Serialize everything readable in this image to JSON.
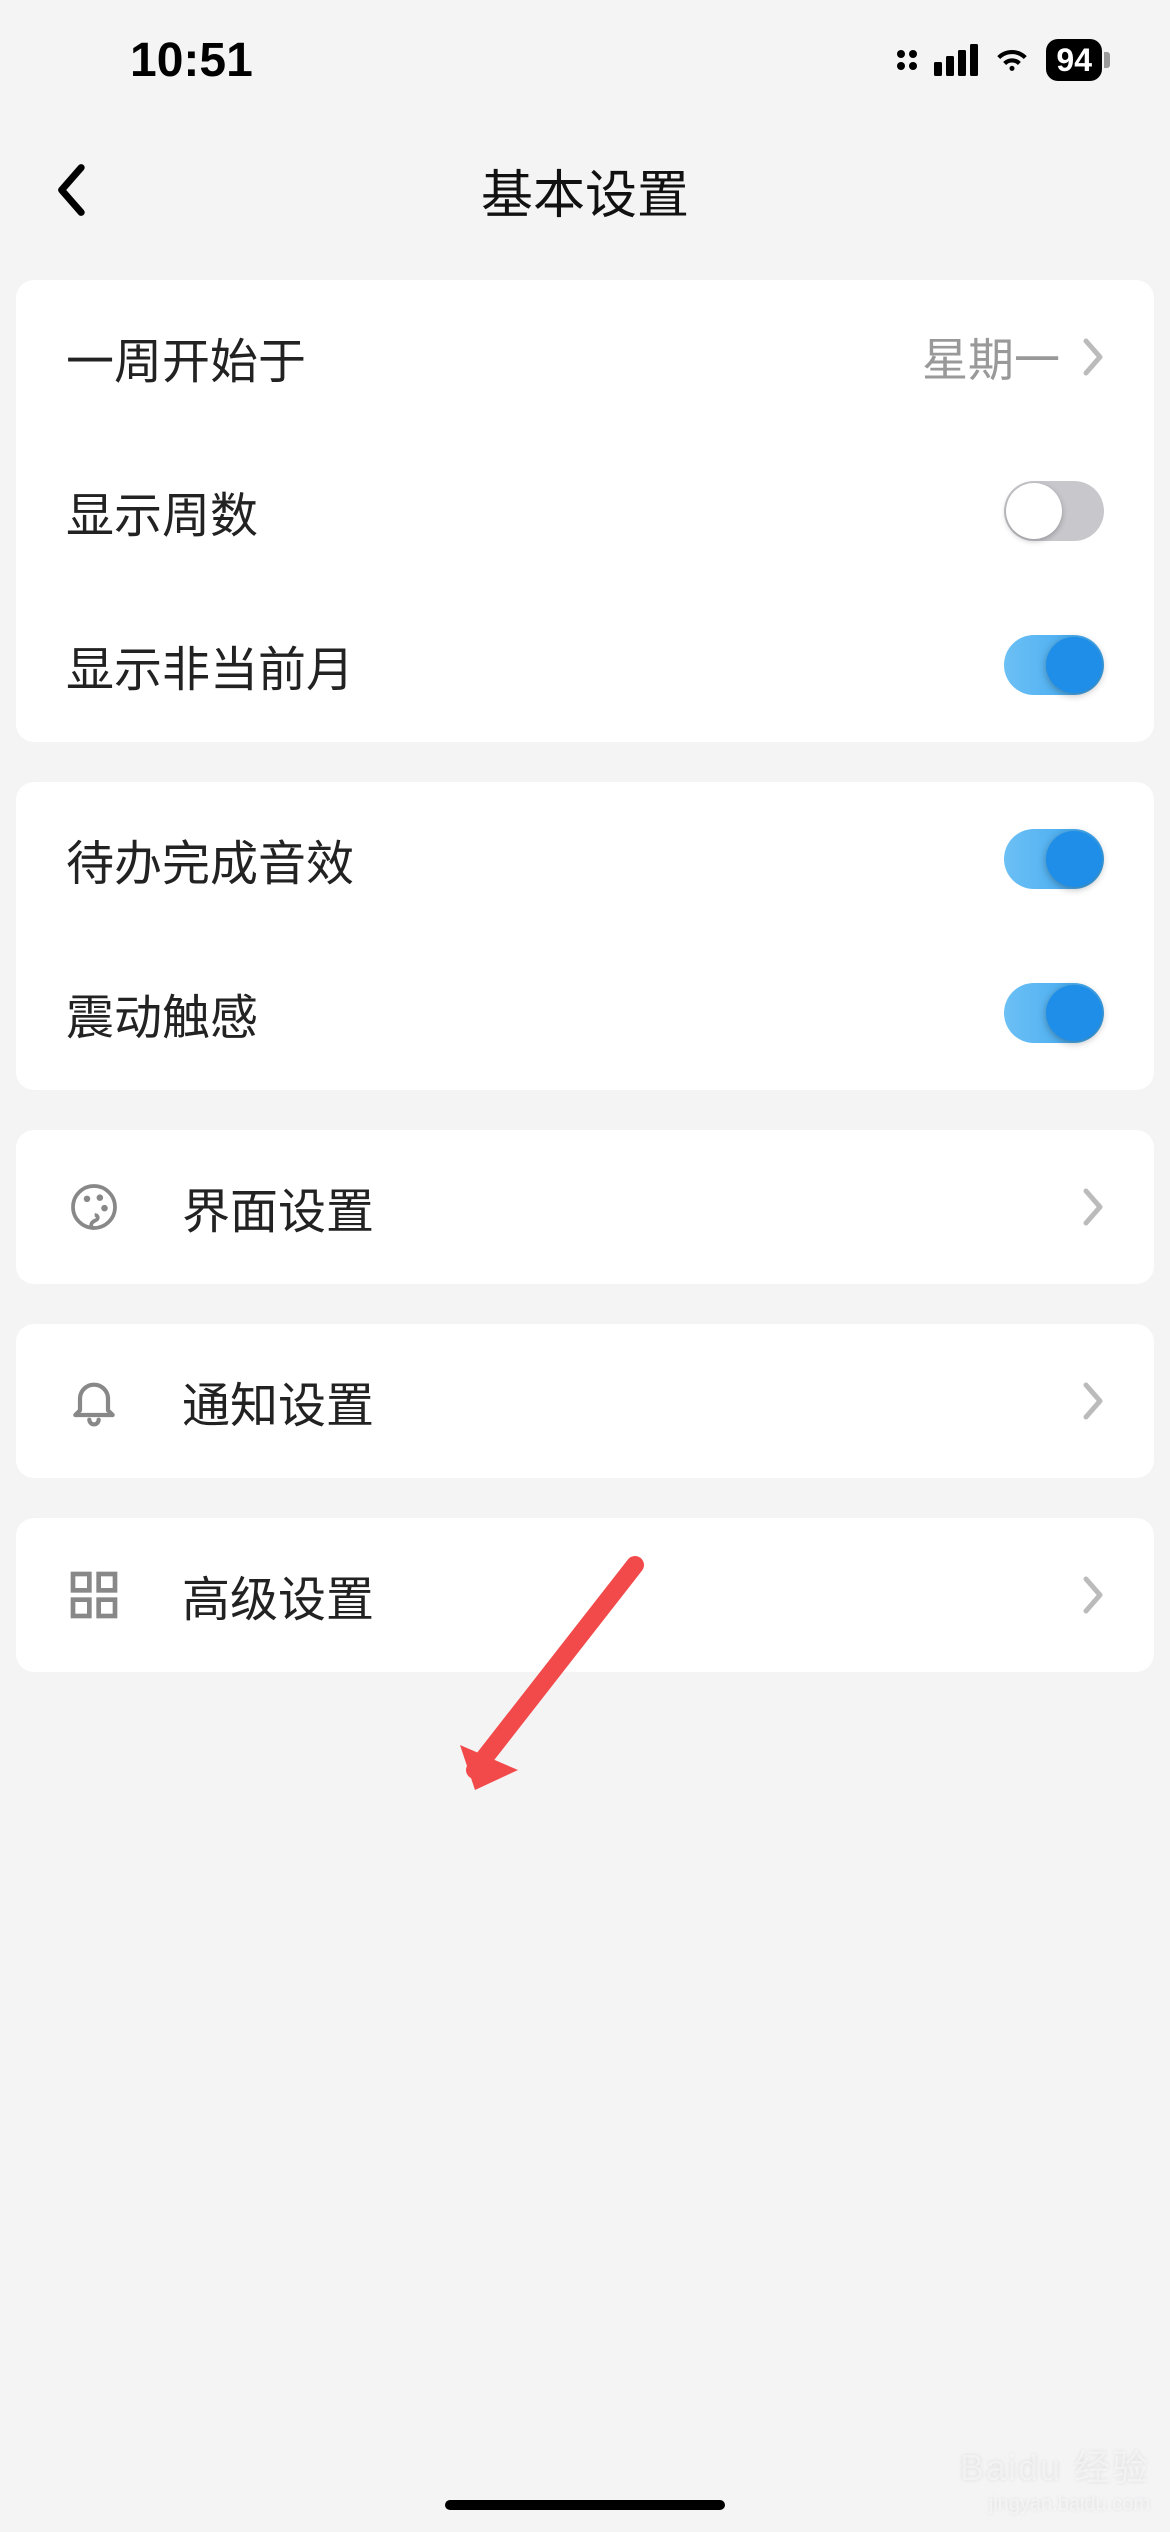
{
  "status": {
    "time": "10:51",
    "battery": "94"
  },
  "nav": {
    "title": "基本设置"
  },
  "group1": {
    "weekStart": {
      "label": "一周开始于",
      "value": "星期一"
    },
    "showWeekNum": {
      "label": "显示周数"
    },
    "showNonCurrentMonth": {
      "label": "显示非当前月"
    }
  },
  "group2": {
    "todoSound": {
      "label": "待办完成音效"
    },
    "haptic": {
      "label": "震动触感"
    }
  },
  "links": {
    "ui": {
      "label": "界面设置"
    },
    "notification": {
      "label": "通知设置"
    },
    "advanced": {
      "label": "高级设置"
    }
  },
  "watermark": {
    "main": "Baidu 经验",
    "sub": "jingyan.baidu.com"
  }
}
